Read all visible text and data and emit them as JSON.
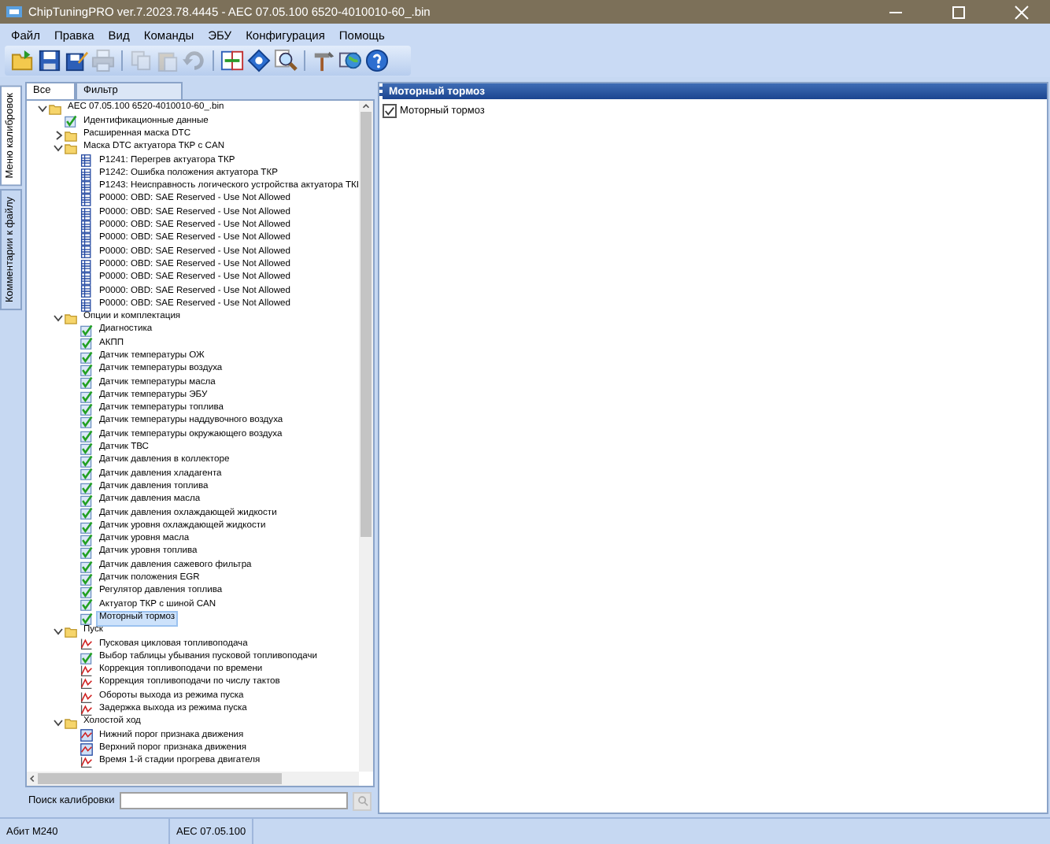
{
  "window": {
    "title": "ChipTuningPRO ver.7.2023.78.4445 - AEC 07.05.100 6520-4010010-60_.bin"
  },
  "menu": [
    "Файл",
    "Правка",
    "Вид",
    "Команды",
    "ЭБУ",
    "Конфигурация",
    "Помощь"
  ],
  "toolbar": [
    {
      "kind": "open",
      "disabled": false
    },
    {
      "kind": "save",
      "disabled": false
    },
    {
      "kind": "saveas",
      "disabled": false
    },
    {
      "kind": "print",
      "disabled": true
    },
    {
      "kind": "sep"
    },
    {
      "kind": "copy",
      "disabled": true
    },
    {
      "kind": "paste",
      "disabled": true
    },
    {
      "kind": "undo",
      "disabled": true
    },
    {
      "kind": "sep"
    },
    {
      "kind": "compare",
      "disabled": false
    },
    {
      "kind": "diamond",
      "disabled": false
    },
    {
      "kind": "search",
      "disabled": false
    },
    {
      "kind": "sep"
    },
    {
      "kind": "tools",
      "disabled": false
    },
    {
      "kind": "globe",
      "disabled": false
    },
    {
      "kind": "help",
      "disabled": false
    }
  ],
  "side_tabs": [
    {
      "label": "Меню калибровок",
      "selected": true
    },
    {
      "label": "Комментарии к файлу",
      "selected": false
    }
  ],
  "panel_tabs": [
    {
      "label": "Все",
      "selected": true
    },
    {
      "label": "Фильтр",
      "selected": false
    }
  ],
  "tree": [
    {
      "label": "AEC 07.05.100 6520-4010010-60_.bin",
      "kind": "folder",
      "expanded": true,
      "selected": false,
      "children": [
        {
          "label": "Идентификационные данные",
          "kind": "check",
          "selected": false
        },
        {
          "label": "Расширенная маска DTC",
          "kind": "folder",
          "expanded": false,
          "selected": false
        },
        {
          "label": "Маска DTC актуатора ТКР с CAN",
          "kind": "folder",
          "expanded": true,
          "selected": false,
          "children": [
            {
              "label": "P1241: Перегрев актуатора ТКР",
              "kind": "table",
              "selected": false
            },
            {
              "label": "P1242: Ошибка положения актуатора ТКР",
              "kind": "table",
              "selected": false
            },
            {
              "label": "P1243: Неисправность логического устройства актуатора ТКI",
              "kind": "table",
              "selected": false
            },
            {
              "label": "P0000: OBD: SAE Reserved - Use Not Allowed",
              "kind": "table",
              "selected": false
            },
            {
              "label": "P0000: OBD: SAE Reserved - Use Not Allowed",
              "kind": "table",
              "selected": false
            },
            {
              "label": "P0000: OBD: SAE Reserved - Use Not Allowed",
              "kind": "table",
              "selected": false
            },
            {
              "label": "P0000: OBD: SAE Reserved - Use Not Allowed",
              "kind": "table",
              "selected": false
            },
            {
              "label": "P0000: OBD: SAE Reserved - Use Not Allowed",
              "kind": "table",
              "selected": false
            },
            {
              "label": "P0000: OBD: SAE Reserved - Use Not Allowed",
              "kind": "table",
              "selected": false
            },
            {
              "label": "P0000: OBD: SAE Reserved - Use Not Allowed",
              "kind": "table",
              "selected": false
            },
            {
              "label": "P0000: OBD: SAE Reserved - Use Not Allowed",
              "kind": "table",
              "selected": false
            },
            {
              "label": "P0000: OBD: SAE Reserved - Use Not Allowed",
              "kind": "table",
              "selected": false
            }
          ]
        },
        {
          "label": "Опции и комплектация",
          "kind": "folder",
          "expanded": true,
          "selected": false,
          "children": [
            {
              "label": "Диагностика",
              "kind": "check",
              "selected": false
            },
            {
              "label": "АКПП",
              "kind": "check",
              "selected": false
            },
            {
              "label": "Датчик температуры ОЖ",
              "kind": "check",
              "selected": false
            },
            {
              "label": "Датчик температуры воздуха",
              "kind": "check",
              "selected": false
            },
            {
              "label": "Датчик температуры масла",
              "kind": "check",
              "selected": false
            },
            {
              "label": "Датчик температуры ЭБУ",
              "kind": "check",
              "selected": false
            },
            {
              "label": "Датчик температуры топлива",
              "kind": "check",
              "selected": false
            },
            {
              "label": "Датчик температуры наддувочного воздуха",
              "kind": "check",
              "selected": false
            },
            {
              "label": "Датчик температуры окружающего воздуха",
              "kind": "check",
              "selected": false
            },
            {
              "label": "Датчик ТВС",
              "kind": "check",
              "selected": false
            },
            {
              "label": "Датчик давления в коллекторе",
              "kind": "check",
              "selected": false
            },
            {
              "label": "Датчик давления хладагента",
              "kind": "check",
              "selected": false
            },
            {
              "label": "Датчик давления топлива",
              "kind": "check",
              "selected": false
            },
            {
              "label": "Датчик давления масла",
              "kind": "check",
              "selected": false
            },
            {
              "label": "Датчик давления охлаждающей жидкости",
              "kind": "check",
              "selected": false
            },
            {
              "label": "Датчик уровня охлаждающей жидкости",
              "kind": "check",
              "selected": false
            },
            {
              "label": "Датчик уровня масла",
              "kind": "check",
              "selected": false
            },
            {
              "label": "Датчик уровня топлива",
              "kind": "check",
              "selected": false
            },
            {
              "label": "Датчик давления сажевого фильтра",
              "kind": "check",
              "selected": false
            },
            {
              "label": "Датчик положения EGR",
              "kind": "check",
              "selected": false
            },
            {
              "label": "Регулятор давления топлива",
              "kind": "check",
              "selected": false
            },
            {
              "label": "Актуатор ТКР с шиной CAN",
              "kind": "check",
              "selected": false
            },
            {
              "label": "Моторный тормоз",
              "kind": "check",
              "selected": true
            }
          ]
        },
        {
          "label": "Пуск",
          "kind": "folder",
          "expanded": true,
          "selected": false,
          "children": [
            {
              "label": "Пусковая цикловая топливоподача",
              "kind": "curve",
              "selected": false
            },
            {
              "label": "Выбор таблицы убывания пусковой топливоподачи",
              "kind": "check",
              "selected": false
            },
            {
              "label": "Коррекция топливоподачи по времени",
              "kind": "curve",
              "selected": false
            },
            {
              "label": "Коррекция топливоподачи по числу тактов",
              "kind": "curve",
              "selected": false
            },
            {
              "label": "Обороты выхода из режима пуска",
              "kind": "curve",
              "selected": false
            },
            {
              "label": "Задержка выхода из режима пуска",
              "kind": "curve",
              "selected": false
            }
          ]
        },
        {
          "label": "Холостой ход",
          "kind": "folder",
          "expanded": true,
          "selected": false,
          "children": [
            {
              "label": "Нижний порог признака движения",
              "kind": "map",
              "selected": false
            },
            {
              "label": "Верхний порог признака движения",
              "kind": "map",
              "selected": false
            },
            {
              "label": "Время 1-й стадии прогрева двигателя",
              "kind": "curve",
              "selected": false
            }
          ]
        }
      ]
    }
  ],
  "search": {
    "label": "Поиск калибровки"
  },
  "detail": {
    "title": "Моторный тормоз",
    "option": {
      "label": "Моторный тормоз",
      "checked": true
    }
  },
  "status_bar": [
    "Абит М240",
    "AEC 07.05.100"
  ]
}
